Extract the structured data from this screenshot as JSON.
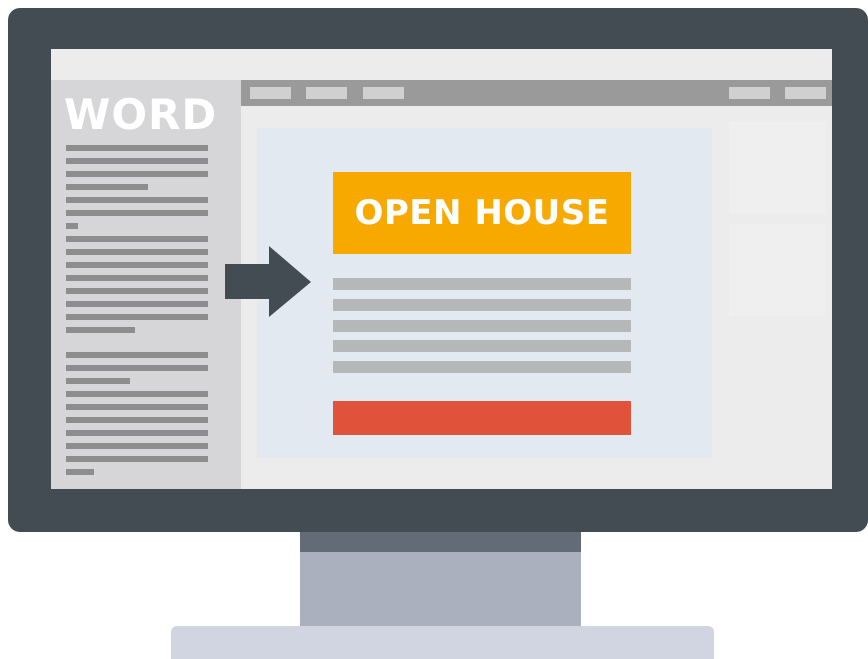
{
  "app": {
    "doc_label": "WORD",
    "flyer_heading": "OPEN HOUSE"
  },
  "icons": {
    "arrow": "right-arrow-icon"
  },
  "colors": {
    "monitor": "#434c53",
    "banner": "#f7a900",
    "cta": "#e0523a",
    "canvas": "#e2e9f0"
  }
}
